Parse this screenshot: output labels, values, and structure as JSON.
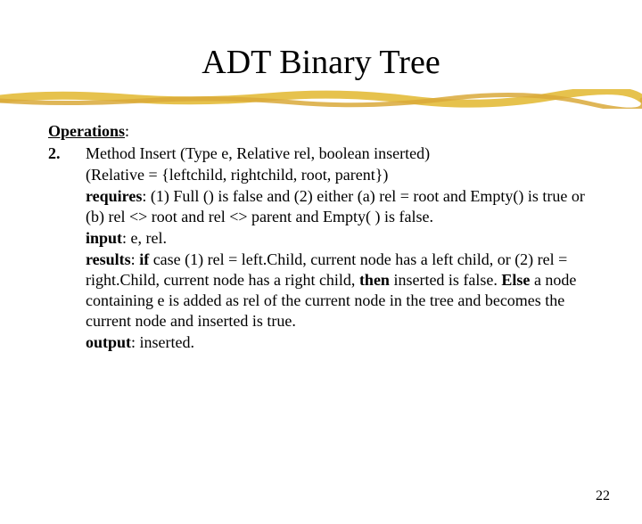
{
  "title": "ADT Binary Tree",
  "operations_heading": "Operations",
  "item_number": "2.",
  "method_signature": "Method Insert (Type e, Relative rel, boolean inserted)",
  "relative_def": "(Relative = {leftchild, rightchild, root, parent})",
  "requires_label": "requires",
  "requires_text": ": (1) Full () is false and (2) either (a) rel = root and Empty() is true or (b) rel <> root and rel <> parent and Empty( ) is false.",
  "input_label": "input",
  "input_text": ": e, rel.",
  "results_label": "results",
  "results_pre": ": ",
  "if_label": "if",
  "results_mid": " case (1) rel = left.Child, current node has a left child, or (2) rel = right.Child, current node has a right child, ",
  "then_label": "then",
  "results_mid2": " inserted is false. ",
  "else_label": "Else",
  "results_tail": " a node containing e is added as rel of the current node in the tree and becomes the current node and inserted is true.",
  "output_label": "output",
  "output_text": ": inserted.",
  "page_number": "22"
}
